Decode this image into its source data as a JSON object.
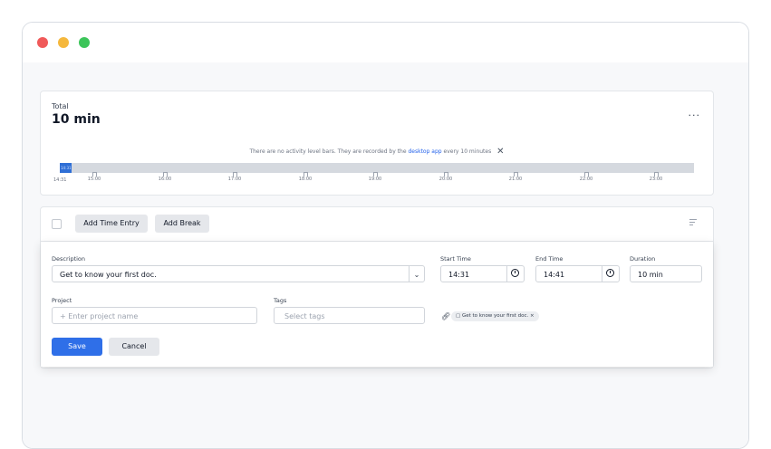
{
  "summary": {
    "total_label": "Total",
    "total_value": "10 min",
    "more": "···",
    "notice_pre": "There are no activity level bars. They are recorded by the",
    "notice_link": "desktop app",
    "notice_post": "every 10 minutes",
    "close_glyph": "✕",
    "segment_label": "14:31",
    "start_label": "14:31",
    "ticks": [
      "15:00",
      "16:00",
      "17:00",
      "18:00",
      "19:00",
      "20:00",
      "21:00",
      "22:00",
      "23:00"
    ]
  },
  "toolbar": {
    "add_time_entry": "Add Time Entry",
    "add_break": "Add Break"
  },
  "form": {
    "description_label": "Description",
    "description_value": "Get to know your first doc.",
    "start_label": "Start Time",
    "start_value": "14:31",
    "end_label": "End Time",
    "end_value": "14:41",
    "duration_label": "Duration",
    "duration_value": "10 min",
    "project_label": "Project",
    "project_placeholder": "+ Enter project name",
    "tags_label": "Tags",
    "tags_placeholder": "Select tags",
    "link_chip": "Get to know your first doc.",
    "save": "Save",
    "cancel": "Cancel"
  },
  "colors": {
    "accent": "#2f6fe8",
    "timeline_segment": "#2f6fd6",
    "traffic_red": "#f05a5a",
    "traffic_yellow": "#f5b83d",
    "traffic_green": "#3cc55a"
  }
}
